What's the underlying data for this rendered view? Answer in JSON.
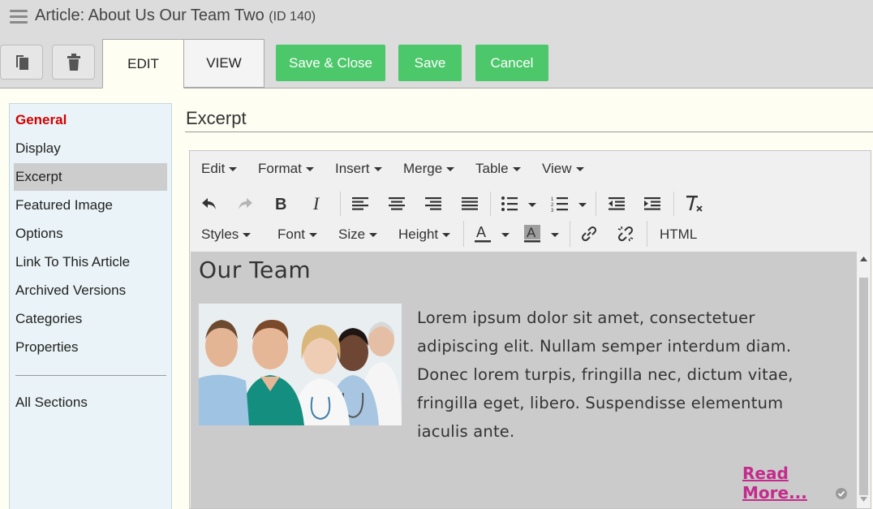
{
  "header": {
    "title": "Article: About Us Our Team Two",
    "id_label": "(ID 140)"
  },
  "toolbar": {
    "tabs": [
      "EDIT",
      "VIEW"
    ],
    "save_close": "Save & Close",
    "save": "Save",
    "cancel": "Cancel",
    "accent_color": "#4cc76a"
  },
  "sidebar": {
    "items": [
      "General",
      "Display",
      "Excerpt",
      "Featured Image",
      "Options",
      "Link To This Article",
      "Archived Versions",
      "Categories",
      "Properties"
    ],
    "all_sections": "All Sections",
    "active": "General",
    "selected": "Excerpt"
  },
  "section": {
    "title": "Excerpt"
  },
  "editor": {
    "menu": [
      "Edit",
      "Format",
      "Insert",
      "Merge",
      "Table",
      "View"
    ],
    "row2": [
      "Styles",
      "Font",
      "Size",
      "Height"
    ],
    "html_label": "HTML",
    "content": {
      "heading": "Our Team",
      "paragraph": "Lorem ipsum dolor sit amet, consectetuer adipiscing elit. Nullam semper interdum diam. Donec lorem turpis, fringilla nec, dictum vitae, fringilla eget, libero. Suspendisse elementum iaculis ante.",
      "read_more": "Read More..."
    }
  }
}
